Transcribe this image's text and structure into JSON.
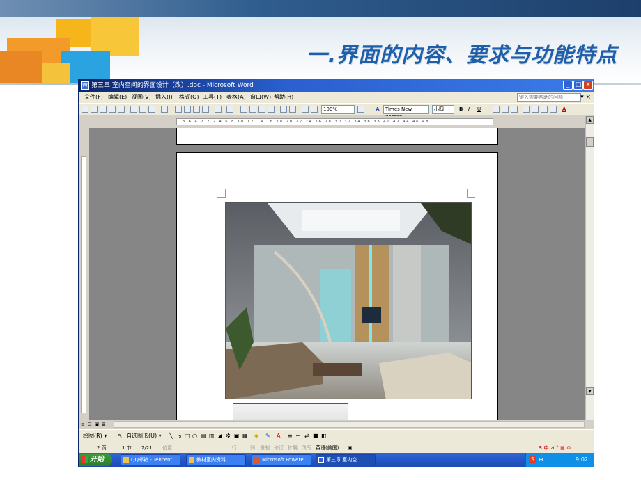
{
  "slide": {
    "title": "一.界面的内容、要求与功能特点"
  },
  "window": {
    "title": "第三章  室内空间的界面设计（改）.doc - Microsoft Word",
    "app_icon": "word-icon",
    "controls": {
      "minimize": "_",
      "maximize": "□",
      "close": "×"
    }
  },
  "menu": {
    "items": [
      "文件(F)",
      "编辑(E)",
      "视图(V)",
      "插入(I)",
      "格式(O)",
      "工具(T)",
      "表格(A)",
      "窗口(W)",
      "帮助(H)"
    ],
    "help_placeholder": "键入需要帮助的问题",
    "close": "▾ ×"
  },
  "toolbar": {
    "zoom": "100%",
    "font": "Times New Roman",
    "size": "小四",
    "bold": "B",
    "italic": "I",
    "underline": "U",
    "font_color": "A",
    "style_glyph": "A"
  },
  "ruler": {
    "numbers": "8  6  4  2  2  2  4  6  8  10  12  14  16  18  20  22  24  26  28  30  32  34  36  38  40  42  44  46  48"
  },
  "drawbar": {
    "draw": "绘图(R) ▾",
    "autoshapes": "自选图形(U) ▾"
  },
  "status": {
    "page": "2 页",
    "section": "1 节",
    "page_of": "2/21",
    "at": "位置:",
    "line": "行",
    "col": "列",
    "rec": "录制",
    "trk": "修订",
    "ext": "扩展",
    "ovr": "改写",
    "lang": "英语(美国)"
  },
  "taskbar": {
    "start": "开始",
    "tasks": [
      {
        "label": "QQ邮箱 - Tencent..."
      },
      {
        "label": "教材室内资料"
      },
      {
        "label": "Microsoft PowerP..."
      },
      {
        "label": "第三章  室内空..."
      }
    ],
    "tray_time": "9:02"
  },
  "colors": {
    "accent_title": "#1f5ea8",
    "titlebar": "#0a246a",
    "taskbar": "#2457c7"
  }
}
